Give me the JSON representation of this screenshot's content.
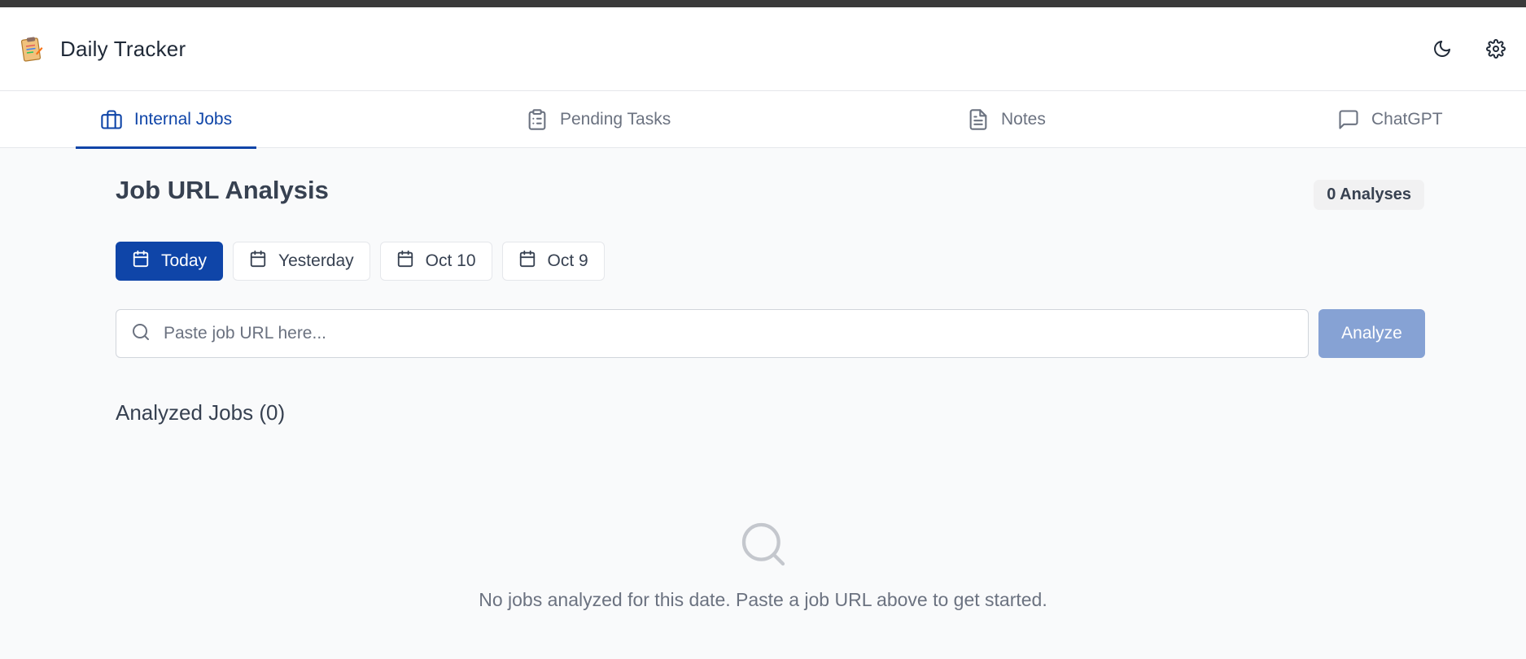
{
  "app": {
    "title": "Daily Tracker"
  },
  "tabs": [
    {
      "label": "Internal Jobs",
      "icon": "briefcase-icon",
      "active": true
    },
    {
      "label": "Pending Tasks",
      "icon": "clipboard-list-icon",
      "active": false
    },
    {
      "label": "Notes",
      "icon": "file-text-icon",
      "active": false
    },
    {
      "label": "ChatGPT",
      "icon": "message-square-icon",
      "active": false
    }
  ],
  "header_actions": {
    "theme_icon": "moon-icon",
    "settings_icon": "gear-icon"
  },
  "main": {
    "title": "Job URL Analysis",
    "count_badge": "0 Analyses",
    "date_filters": [
      {
        "label": "Today",
        "active": true
      },
      {
        "label": "Yesterday",
        "active": false
      },
      {
        "label": "Oct 10",
        "active": false
      },
      {
        "label": "Oct 9",
        "active": false
      }
    ],
    "search": {
      "placeholder": "Paste job URL here...",
      "value": ""
    },
    "analyze_label": "Analyze",
    "analyzed_title": "Analyzed Jobs (0)",
    "empty_message": "No jobs analyzed for this date. Paste a job URL above to get started."
  },
  "colors": {
    "accent": "#0f45a8",
    "accent_disabled": "#86a2d4",
    "muted_text": "#6b7280"
  }
}
